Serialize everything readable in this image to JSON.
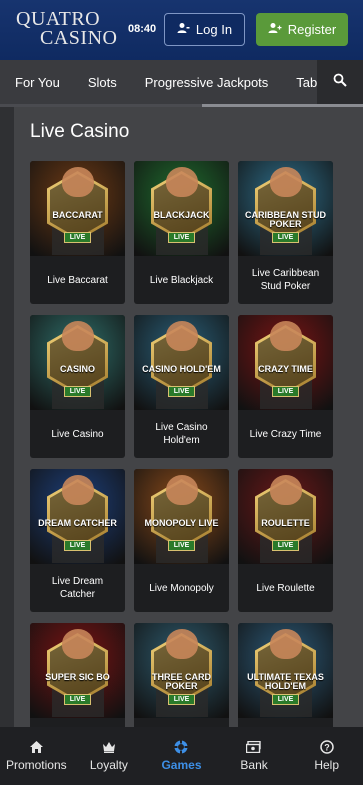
{
  "header": {
    "logo_line1": "QUATRO",
    "logo_line2": "CASINO",
    "time": "08:40",
    "login_label": "Log In",
    "register_label": "Register"
  },
  "nav": {
    "items": [
      "For You",
      "Slots",
      "Progressive Jackpots",
      "Table"
    ]
  },
  "section": {
    "title": "Live Casino"
  },
  "tiles": [
    {
      "label": "Live Baccarat",
      "badge": "BACCARAT",
      "bg": "#6e3a14"
    },
    {
      "label": "Live Blackjack",
      "badge": "BLACKJACK",
      "bg": "#1f6b2e"
    },
    {
      "label": "Live Caribbean Stud Poker",
      "badge": "CARIBBEAN STUD POKER",
      "bg": "#2e6e8a"
    },
    {
      "label": "Live Casino",
      "badge": "CASINO",
      "bg": "#2f6f6a"
    },
    {
      "label": "Live Casino Hold'em",
      "badge": "CASINO HOLD'EM",
      "bg": "#2a5f78"
    },
    {
      "label": "Live Crazy Time",
      "badge": "CRAZY TIME",
      "bg": "#7a1414"
    },
    {
      "label": "Live Dream Catcher",
      "badge": "DREAM CATCHER",
      "bg": "#1d3f7a"
    },
    {
      "label": "Live Monopoly",
      "badge": "MONOPOLY LIVE",
      "bg": "#8a4a1a"
    },
    {
      "label": "Live Roulette",
      "badge": "ROULETTE",
      "bg": "#6a1818"
    },
    {
      "label": "",
      "badge": "SUPER SIC BO",
      "bg": "#7a1212"
    },
    {
      "label": "",
      "badge": "THREE CARD POKER",
      "bg": "#2e5b6e"
    },
    {
      "label": "",
      "badge": "ULTIMATE TEXAS HOLD'EM",
      "bg": "#2c5a78"
    }
  ],
  "live_text": "LIVE",
  "bottom_nav": [
    {
      "label": "Promotions",
      "icon": "home-icon"
    },
    {
      "label": "Loyalty",
      "icon": "crown-icon"
    },
    {
      "label": "Games",
      "icon": "chip-icon",
      "active": true
    },
    {
      "label": "Bank",
      "icon": "cash-icon"
    },
    {
      "label": "Help",
      "icon": "help-icon"
    }
  ],
  "colors": {
    "header_bg": "#17346f",
    "register_green": "#5a9a3a",
    "active_blue": "#3d8fe6"
  }
}
